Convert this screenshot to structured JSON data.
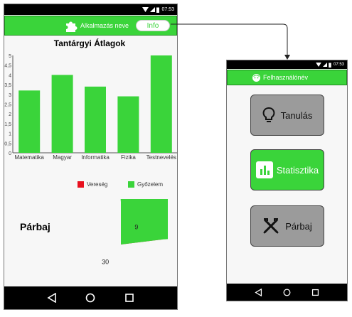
{
  "status_time": "07:53",
  "app_bar": {
    "title": "Alkalmazás neve",
    "info_button": "Info"
  },
  "user_bar": {
    "title": "Felhasználónév"
  },
  "menu": {
    "learn": "Tanulás",
    "stats": "Statisztika",
    "duel": "Párbaj"
  },
  "duel_section": {
    "title": "Párbaj"
  },
  "chart_data": [
    {
      "type": "bar",
      "title": "Tantárgyi Átlagok",
      "categories": [
        "Matematika",
        "Magyar",
        "Informatika",
        "Fizika",
        "Testnevelés"
      ],
      "values": [
        3.2,
        4.0,
        3.4,
        2.9,
        5.0
      ],
      "yticks": [
        "0",
        "0,5",
        "1",
        "1,5",
        "2",
        "2,5",
        "3",
        "3,5",
        "4",
        "4,5",
        "5"
      ],
      "ylim": [
        0,
        5
      ],
      "color": "#3ad43a"
    },
    {
      "type": "pie",
      "legend": [
        {
          "name": "Vereség",
          "color": "#e8101e"
        },
        {
          "name": "Győzelem",
          "color": "#3ad43a"
        }
      ],
      "slices": [
        {
          "name": "Vereség",
          "value": 9,
          "label": "9",
          "color": "#e8101e"
        },
        {
          "name": "Győzelem",
          "value": 30,
          "label": "30",
          "color": "#3ad43a"
        }
      ]
    }
  ],
  "colors": {
    "accent": "#3ad43a",
    "loss": "#e8101e",
    "button_gray": "#9b9b9b"
  }
}
